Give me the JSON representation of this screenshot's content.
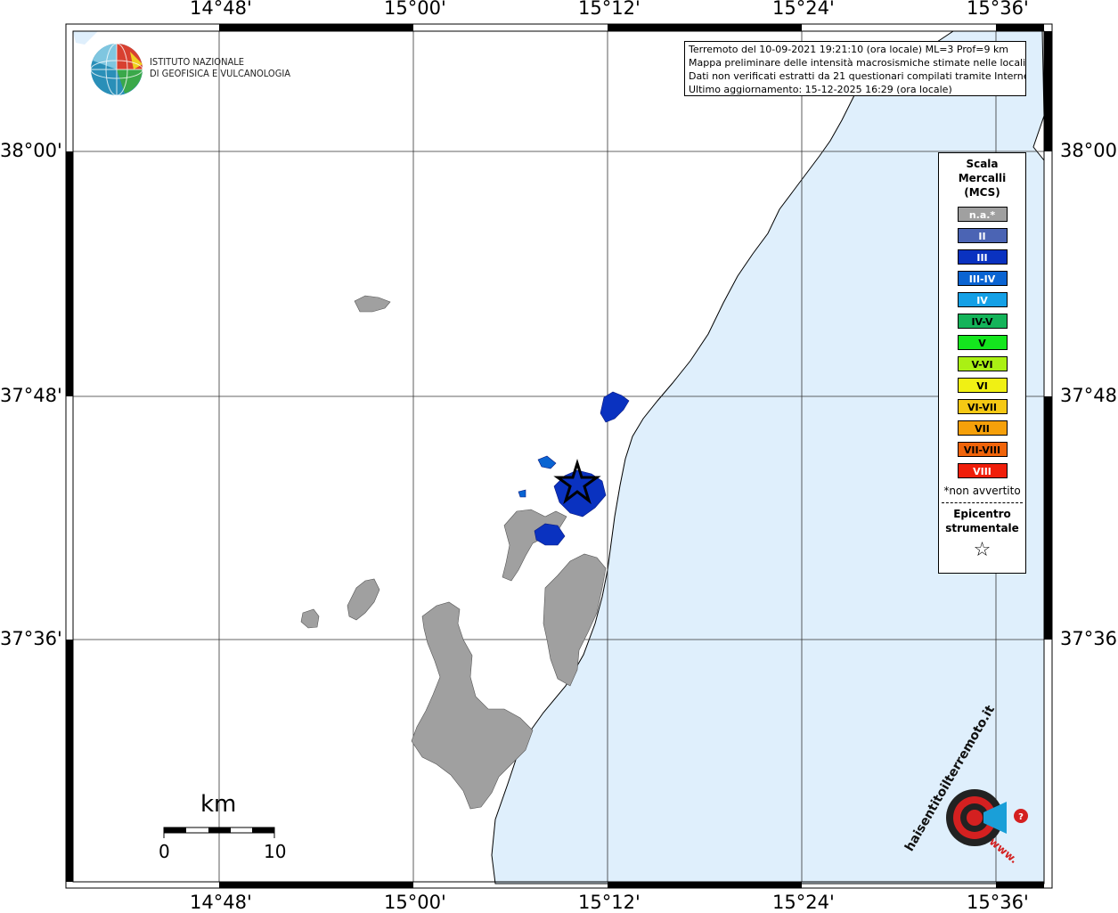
{
  "title_box": {
    "line1": "Terremoto del 10-09-2021 19:21:10 (ora locale) ML=3 Prof=9 km",
    "line2": "Mappa preliminare delle intensità macrosismiche stimate nelle località",
    "line3": "Dati non verificati estratti da 21 questionari compilati tramite Internet.",
    "line4": "Ultimo aggiornamento: 15-12-2025 16:29 (ora locale)"
  },
  "logo": {
    "line1": "ISTITUTO NAZIONALE",
    "line2": "DI GEOFISICA E VULCANOLOGIA"
  },
  "axes": {
    "longitude_labels": [
      "14°48'",
      "15°00'",
      "15°12'",
      "15°24'",
      "15°36'"
    ],
    "latitude_labels": [
      "38°00'",
      "37°48'",
      "37°36'"
    ]
  },
  "legend": {
    "title_line1": "Scala",
    "title_line2": "Mercalli",
    "title_line3": "(MCS)",
    "items": [
      {
        "label": "n.a.*",
        "color": "#a0a0a0"
      },
      {
        "label": "II",
        "color": "#4b64b4"
      },
      {
        "label": "III",
        "color": "#0a32c0"
      },
      {
        "label": "III-IV",
        "color": "#0a64d2"
      },
      {
        "label": "IV",
        "color": "#14a0e6"
      },
      {
        "label": "IV-V",
        "color": "#14b45a"
      },
      {
        "label": "V",
        "color": "#14e61e"
      },
      {
        "label": "V-VI",
        "color": "#aaf014"
      },
      {
        "label": "VI",
        "color": "#f0f014"
      },
      {
        "label": "VI-VII",
        "color": "#f5c814"
      },
      {
        "label": "VII",
        "color": "#f5a00a"
      },
      {
        "label": "VII-VIII",
        "color": "#f0640a"
      },
      {
        "label": "VIII",
        "color": "#f01e0a"
      }
    ],
    "note": "*non avvertito",
    "epicenter_line1": "Epicentro",
    "epicenter_line2": "strumentale",
    "epicenter_symbol": "☆"
  },
  "scale_bar": {
    "unit": "km",
    "min_label": "0",
    "max_label": "10"
  },
  "watermark": {
    "text": "haisentitoilterremoto.it",
    "url_text": "www."
  },
  "colors": {
    "sea": "#dfeffc",
    "land": "#ffffff",
    "na_area": "#a0a0a0",
    "intensity_III": "#0a32c0",
    "intensity_III_IV": "#0a64d2"
  }
}
